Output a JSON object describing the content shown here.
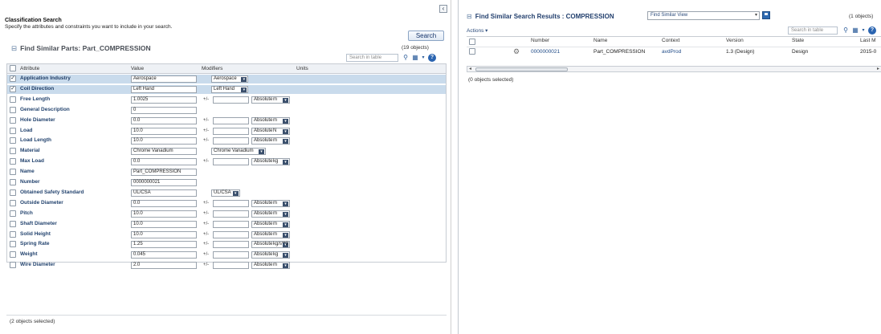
{
  "left": {
    "collapse_icon": "collapse-icon",
    "title": "Classification Search",
    "subtitle": "Specify the attributes and constraints you want to include in your search.",
    "search_button": "Search",
    "section_title": "Find Similar Parts: Part_COMPRESSION",
    "object_count": "(19 objects)",
    "table_search_placeholder": "Search in table",
    "columns": [
      "Attribute",
      "Value",
      "Modifiers",
      "Units"
    ],
    "rows": [
      {
        "attr": "Application Industry",
        "value": "Aerospace",
        "checked": true,
        "modifier": "Aerospace",
        "unit": ""
      },
      {
        "attr": "Coil Direction",
        "value": "Left Hand",
        "checked": true,
        "modifier": "Left Hand",
        "unit": ""
      },
      {
        "attr": "Free Length",
        "value": "1.0025",
        "checked": false,
        "modifier": "Absolute",
        "unit": "m"
      },
      {
        "attr": "General Description",
        "value": "0",
        "checked": false,
        "modifier": "",
        "unit": ""
      },
      {
        "attr": "Hole Diameter",
        "value": "0.0",
        "checked": false,
        "modifier": "Absolute",
        "unit": "m"
      },
      {
        "attr": "Load",
        "value": "10.0",
        "checked": false,
        "modifier": "Absolute",
        "unit": "N"
      },
      {
        "attr": "Load Length",
        "value": "10.0",
        "checked": false,
        "modifier": "Absolute",
        "unit": "m"
      },
      {
        "attr": "Material",
        "value": "Chrome Vanadium",
        "checked": false,
        "modifier": "Chrome Vanadium",
        "unit": ""
      },
      {
        "attr": "Max Load",
        "value": "0.0",
        "checked": false,
        "modifier": "Absolute",
        "unit": "kg"
      },
      {
        "attr": "Name",
        "value": "Part_COMPRESSION",
        "checked": false,
        "modifier": "",
        "unit": ""
      },
      {
        "attr": "Number",
        "value": "0000000021",
        "checked": false,
        "modifier": "",
        "unit": ""
      },
      {
        "attr": "Obtained Safety Standard",
        "value": "UL/CSA",
        "checked": false,
        "modifier": "UL/CSA",
        "unit": ""
      },
      {
        "attr": "Outside Diameter",
        "value": "0.0",
        "checked": false,
        "modifier": "Absolute",
        "unit": "m"
      },
      {
        "attr": "Pitch",
        "value": "10.0",
        "checked": false,
        "modifier": "Absolute",
        "unit": "m"
      },
      {
        "attr": "Shaft Diameter",
        "value": "10.0",
        "checked": false,
        "modifier": "Absolute",
        "unit": "m"
      },
      {
        "attr": "Solid Height",
        "value": "10.0",
        "checked": false,
        "modifier": "Absolute",
        "unit": "m"
      },
      {
        "attr": "Spring Rate",
        "value": "1.25",
        "checked": false,
        "modifier": "Absolute",
        "unit": "kg/s**2"
      },
      {
        "attr": "Weight",
        "value": "0.045",
        "checked": false,
        "modifier": "Absolute",
        "unit": "kg"
      },
      {
        "attr": "Wire Diameter",
        "value": "2.0",
        "checked": false,
        "modifier": "Absolute",
        "unit": "m"
      }
    ],
    "plus_minus": "+/-",
    "status": "(2 objects selected)"
  },
  "right": {
    "title": "Find Similar Search Results : COMPRESSION",
    "view_select": "Find Similar View",
    "object_count": "(1 objects)",
    "actions_label": "Actions ▾",
    "table_search_placeholder": "Search in table",
    "columns": [
      "Number",
      "Name",
      "Context",
      "Version",
      "State",
      "Last M"
    ],
    "result": {
      "number": "0000000021",
      "name": "Part_COMPRESSION",
      "context": "avdProd",
      "version": "1.3 (Design)",
      "state": "Design",
      "last_modified": "2015-0"
    },
    "status": "(0 objects selected)"
  },
  "icons": {
    "find": "search-icon",
    "columns": "column-layout-icon",
    "help": "help-icon",
    "part": "gear-icon",
    "save": "save-icon"
  }
}
